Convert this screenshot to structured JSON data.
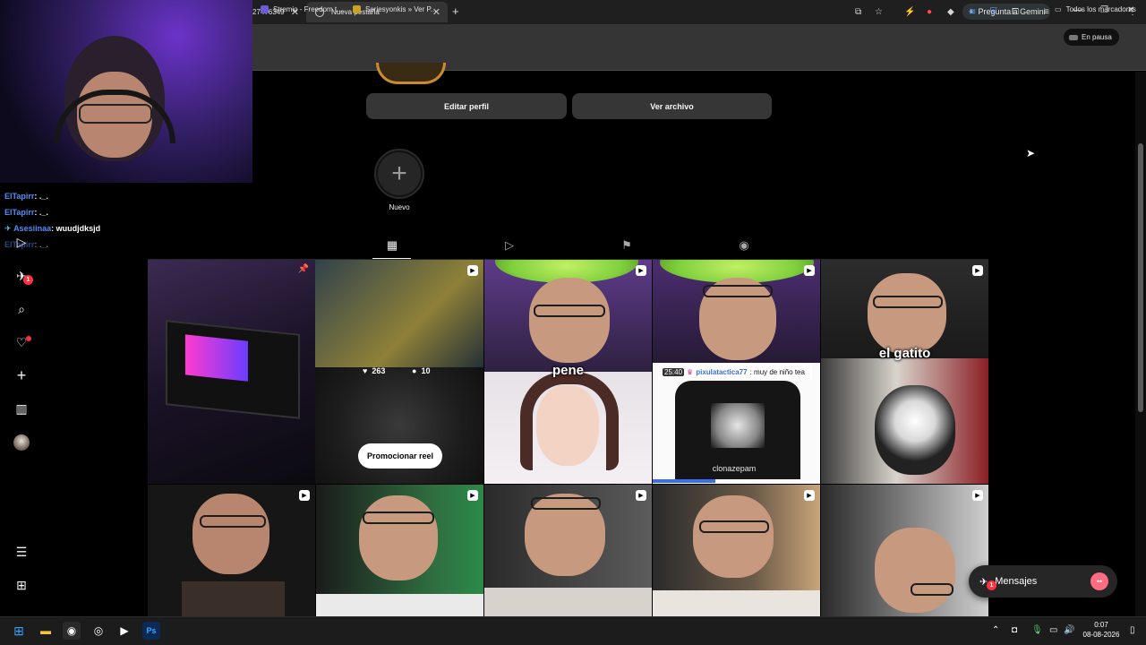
{
  "browser": {
    "tabs": [
      {
        "label": "27476349"
      },
      {
        "label": "Nueva pestaña"
      }
    ],
    "gemini_label": "Pregunta a Gemini",
    "paused_label": "En pausa",
    "bookmarks": [
      {
        "label": "Stremio - Freedom t...",
        "icon_color": "#6b5bd6"
      },
      {
        "label": "Seriesyonkis » Ver P...",
        "icon_color": "#c9a227"
      }
    ],
    "all_bookmarks_label": "Todos los marcadores"
  },
  "stream_chat": {
    "messages": [
      {
        "user": "ElTapirr",
        "text": ": ._.",
        "dim": false
      },
      {
        "user": "ElTapirr",
        "text": ": ._.",
        "dim": false
      },
      {
        "user": "Asesiinaa",
        "text": ": wuudjdksjd",
        "dim": false
      },
      {
        "user": "ElTapirr",
        "text": ": ._.",
        "dim": true
      }
    ]
  },
  "sidebar": {
    "notifications_badge": "1"
  },
  "profile": {
    "edit_label": "Editar perfil",
    "archive_label": "Ver archivo",
    "new_highlight_label": "Nuevo"
  },
  "grid": {
    "first_reel": {
      "likes": "263",
      "comments": "10",
      "promote_label": "Promocionar reel"
    },
    "captions": {
      "pene": "pene",
      "gatito": "el gatito"
    },
    "chat_overlay": {
      "time": "25:40",
      "user": "pixulatactica77",
      "text": ": muy de niño tea"
    },
    "shirt_text": "clonazepam"
  },
  "messages": {
    "label": "Mensajes",
    "badge": "1"
  },
  "taskbar": {
    "time": "0:07",
    "date": "08-08-2026"
  }
}
